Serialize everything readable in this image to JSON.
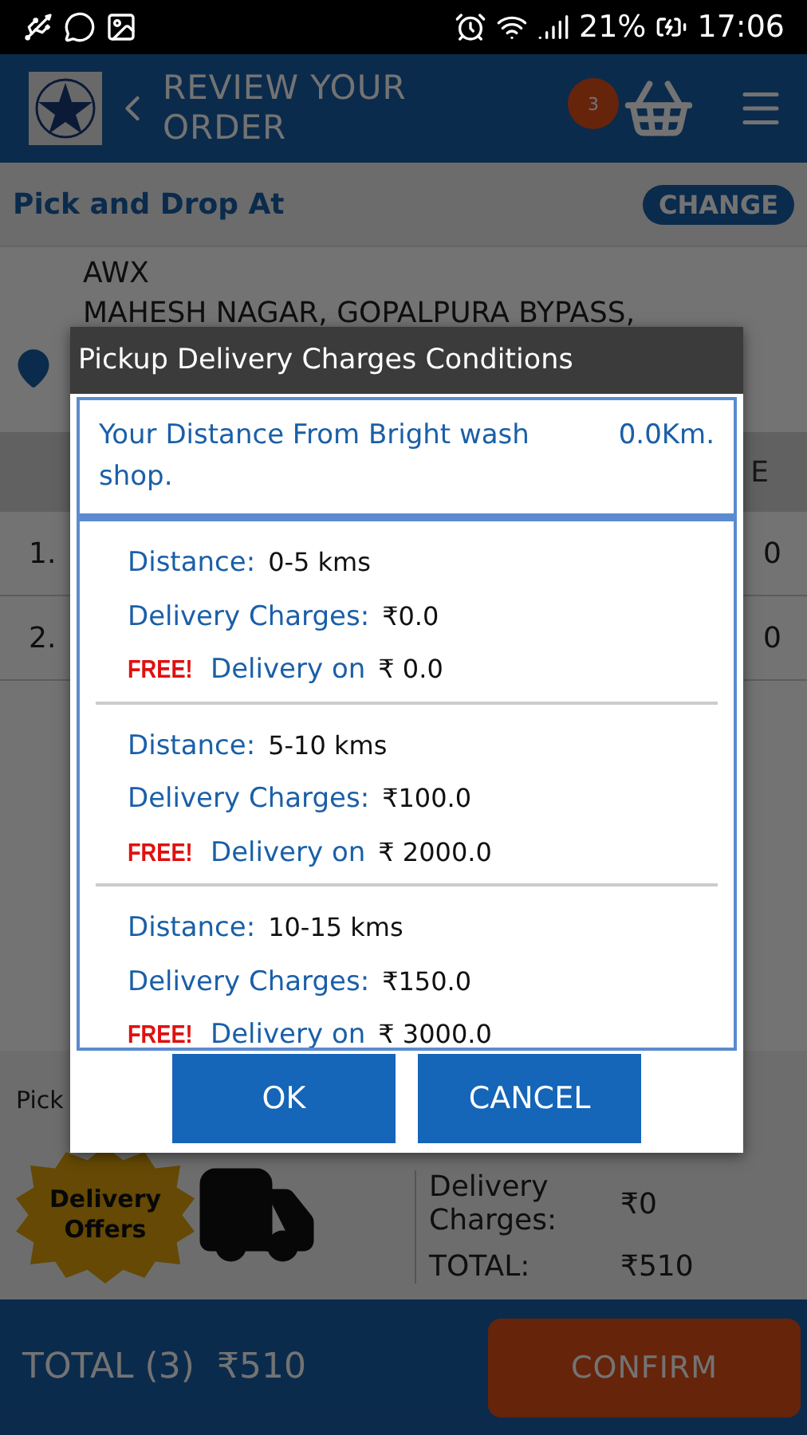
{
  "status_bar": {
    "battery": "21%",
    "time": "17:06"
  },
  "header": {
    "title": "REVIEW YOUR ORDER",
    "cart_count": "3"
  },
  "address": {
    "heading": "Pick and Drop At",
    "change": "CHANGE",
    "name": "AWX",
    "line": "MAHESH NAGAR, GOPALPURA BYPASS,"
  },
  "table": {
    "column_3": "E",
    "rows": [
      {
        "number": "1.",
        "column_3": "0"
      },
      {
        "number": "2.",
        "column_3": "0"
      }
    ]
  },
  "summary": {
    "label": "Pick",
    "badge": "Delivery Offers",
    "rows": [
      {
        "label": "Delivery Charges:",
        "value": "₹0"
      },
      {
        "label": "TOTAL:",
        "value": "₹510"
      }
    ]
  },
  "footer": {
    "total_label": "TOTAL (3)",
    "total": "₹510",
    "confirm": "CONFIRM"
  },
  "dialog": {
    "title": "Pickup Delivery Charges Conditions",
    "distance_label": "Your Distance From Bright wash shop.",
    "distance": "0.0Km.",
    "conditions": [
      {
        "distance_label": "Distance:",
        "distance": "0-5 kms",
        "charges_label": "Delivery Charges:",
        "charges": "₹0.0",
        "free_tag": "FREE!",
        "free_label": "Delivery on",
        "free_amount": "₹ 0.0"
      },
      {
        "distance_label": "Distance:",
        "distance": "5-10 kms",
        "charges_label": "Delivery Charges:",
        "charges": "₹100.0",
        "free_tag": "FREE!",
        "free_label": "Delivery on",
        "free_amount": "₹ 2000.0"
      },
      {
        "distance_label": "Distance:",
        "distance": "10-15 kms",
        "charges_label": "Delivery Charges:",
        "charges": "₹150.0",
        "free_tag": "FREE!",
        "free_label": "Delivery on",
        "free_amount": "₹ 3000.0"
      }
    ],
    "buttons": [
      "OK",
      "CANCEL"
    ]
  }
}
